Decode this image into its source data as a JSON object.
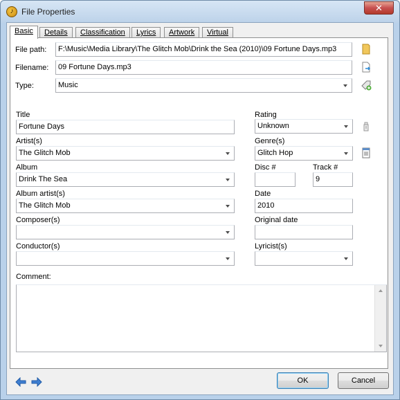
{
  "window": {
    "title": "File Properties",
    "close_glyph": "✕"
  },
  "tabs": [
    "Basic",
    "Details",
    "Classification",
    "Lyrics",
    "Artwork",
    "Virtual CD"
  ],
  "active_tab": "Basic",
  "file": {
    "path_label": "File path:",
    "path_value": "F:\\Music\\Media Library\\The Glitch Mob\\Drink the Sea (2010)\\09 Fortune Days.mp3",
    "filename_label": "Filename:",
    "filename_value": "09 Fortune Days.mp3",
    "type_label": "Type:",
    "type_value": "Music"
  },
  "fields": {
    "title_label": "Title",
    "title_value": "Fortune Days",
    "rating_label": "Rating",
    "rating_value": "Unknown",
    "artist_label": "Artist(s)",
    "artist_value": "The Glitch Mob",
    "genre_label": "Genre(s)",
    "genre_value": "Glitch Hop",
    "album_label": "Album",
    "album_value": "Drink The Sea",
    "disc_label": "Disc #",
    "disc_value": "",
    "track_label": "Track #",
    "track_value": "9",
    "album_artist_label": "Album artist(s)",
    "album_artist_value": "The Glitch Mob",
    "date_label": "Date",
    "date_value": "2010",
    "composer_label": "Composer(s)",
    "composer_value": "",
    "original_date_label": "Original date",
    "original_date_value": "",
    "conductor_label": "Conductor(s)",
    "conductor_value": "",
    "lyricist_label": "Lyricist(s)",
    "lyricist_value": "",
    "comment_label": "Comment:",
    "comment_value": ""
  },
  "buttons": {
    "ok": "OK",
    "cancel": "Cancel"
  },
  "icons": {
    "folder": "folder-icon",
    "rename": "rename-file-icon",
    "edit_type": "edit-type-icon",
    "rating_tool": "rating-tool-icon",
    "genre_list": "genre-list-icon",
    "prev": "previous-arrow-icon",
    "next": "next-arrow-icon"
  },
  "colors": {
    "window_frame": "#b9d1ea",
    "close": "#c75050",
    "arrow": "#3f7fd1"
  }
}
